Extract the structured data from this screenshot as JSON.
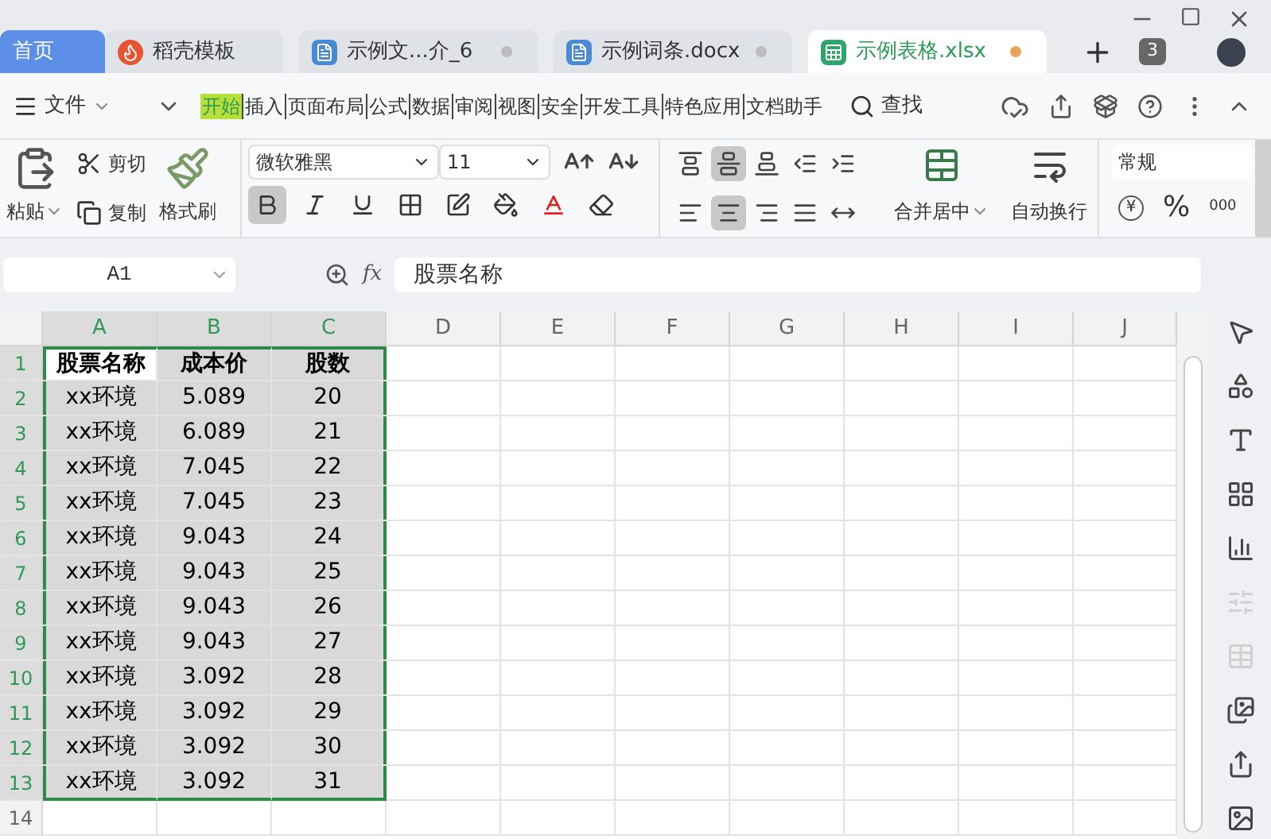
{
  "tabs": [
    {
      "label": "首页",
      "kind": "home",
      "selected": false
    },
    {
      "label": "稻壳模板",
      "kind": "template",
      "selected": false
    },
    {
      "label": "示例文...介_6",
      "kind": "writer",
      "selected": false,
      "color": "#bdbdbd"
    },
    {
      "label": "示例词条.docx",
      "kind": "writer",
      "selected": false,
      "color": "#bdbdbd"
    },
    {
      "label": "示例表格.xlsx",
      "kind": "sheet",
      "selected": true,
      "color": "#e8a25a"
    }
  ],
  "tab_count": "3",
  "menu": {
    "file": "文件",
    "items": [
      {
        "label": "开始",
        "selected": true
      },
      {
        "label": "插入",
        "selected": false
      },
      {
        "label": "页面布局",
        "selected": false
      },
      {
        "label": "公式",
        "selected": false
      },
      {
        "label": "数据",
        "selected": false
      },
      {
        "label": "审阅",
        "selected": false
      },
      {
        "label": "视图",
        "selected": false
      },
      {
        "label": "安全",
        "selected": false
      },
      {
        "label": "开发工具",
        "selected": false
      },
      {
        "label": "特色应用",
        "selected": false
      },
      {
        "label": "文档助手",
        "selected": false
      }
    ],
    "search": "查找"
  },
  "ribbon": {
    "paste": "粘贴",
    "cut": "剪切",
    "copy": "复制",
    "format_painter": "格式刷",
    "font_name": "微软雅黑",
    "font_size": "11",
    "font_buttons": [
      {
        "kind": "bold",
        "selected": true
      },
      {
        "kind": "italic",
        "selected": false
      },
      {
        "kind": "underline",
        "selected": false
      },
      {
        "kind": "border",
        "selected": false
      },
      {
        "kind": "format",
        "selected": false
      },
      {
        "kind": "fill",
        "selected": false
      },
      {
        "kind": "font-color",
        "selected": false
      },
      {
        "kind": "clear",
        "selected": false
      }
    ],
    "align_buttons": [
      {
        "kind": "top",
        "selected": false
      },
      {
        "kind": "middle",
        "selected": true
      },
      {
        "kind": "bottom",
        "selected": false
      },
      {
        "kind": "indent-less",
        "selected": false
      },
      {
        "kind": "indent-more",
        "selected": false
      },
      {
        "kind": "left",
        "selected": false
      },
      {
        "kind": "center",
        "selected": true
      },
      {
        "kind": "right",
        "selected": false
      },
      {
        "kind": "justify",
        "selected": false
      },
      {
        "kind": "distribute",
        "selected": false
      }
    ],
    "merge": "合并居中",
    "wrap": "自动换行",
    "number_format": "常规",
    "currency": "¥",
    "percent": "%",
    "thousands": "000"
  },
  "formula_bar": {
    "cell_ref": "A1",
    "fx": "fx",
    "value": "股票名称"
  },
  "columns": [
    {
      "label": "A",
      "selected": true
    },
    {
      "label": "B",
      "selected": true
    },
    {
      "label": "C",
      "selected": true
    },
    {
      "label": "D",
      "selected": false
    },
    {
      "label": "E",
      "selected": false
    },
    {
      "label": "F",
      "selected": false
    },
    {
      "label": "G",
      "selected": false
    },
    {
      "label": "H",
      "selected": false
    },
    {
      "label": "I",
      "selected": false
    },
    {
      "label": "J",
      "selected": false
    }
  ],
  "rows": [
    {
      "number": "1",
      "selected": true,
      "cells": [
        "股票名称",
        "成本价",
        "股数"
      ]
    },
    {
      "number": "2",
      "selected": true,
      "cells": [
        "xx环境",
        "5.089",
        "20"
      ]
    },
    {
      "number": "3",
      "selected": true,
      "cells": [
        "xx环境",
        "6.089",
        "21"
      ]
    },
    {
      "number": "4",
      "selected": true,
      "cells": [
        "xx环境",
        "7.045",
        "22"
      ]
    },
    {
      "number": "5",
      "selected": true,
      "cells": [
        "xx环境",
        "7.045",
        "23"
      ]
    },
    {
      "number": "6",
      "selected": true,
      "cells": [
        "xx环境",
        "9.043",
        "24"
      ]
    },
    {
      "number": "7",
      "selected": true,
      "cells": [
        "xx环境",
        "9.043",
        "25"
      ]
    },
    {
      "number": "8",
      "selected": true,
      "cells": [
        "xx环境",
        "9.043",
        "26"
      ]
    },
    {
      "number": "9",
      "selected": true,
      "cells": [
        "xx环境",
        "9.043",
        "27"
      ]
    },
    {
      "number": "10",
      "selected": true,
      "cells": [
        "xx环境",
        "3.092",
        "28"
      ]
    },
    {
      "number": "11",
      "selected": true,
      "cells": [
        "xx环境",
        "3.092",
        "29"
      ]
    },
    {
      "number": "12",
      "selected": true,
      "cells": [
        "xx环境",
        "3.092",
        "30"
      ]
    },
    {
      "number": "13",
      "selected": true,
      "cells": [
        "xx环境",
        "3.092",
        "31"
      ]
    },
    {
      "number": "14",
      "selected": false,
      "cells": []
    }
  ],
  "side_tools": [
    {
      "kind": "pointer",
      "disabled": false
    },
    {
      "kind": "shapes",
      "disabled": false
    },
    {
      "kind": "text-style",
      "disabled": false
    },
    {
      "kind": "grid",
      "disabled": false
    },
    {
      "kind": "chart",
      "disabled": false
    },
    {
      "kind": "sliders",
      "disabled": true
    },
    {
      "kind": "table",
      "disabled": true
    },
    {
      "kind": "gallery",
      "disabled": false
    },
    {
      "kind": "share",
      "disabled": false
    },
    {
      "kind": "image",
      "disabled": false
    }
  ]
}
